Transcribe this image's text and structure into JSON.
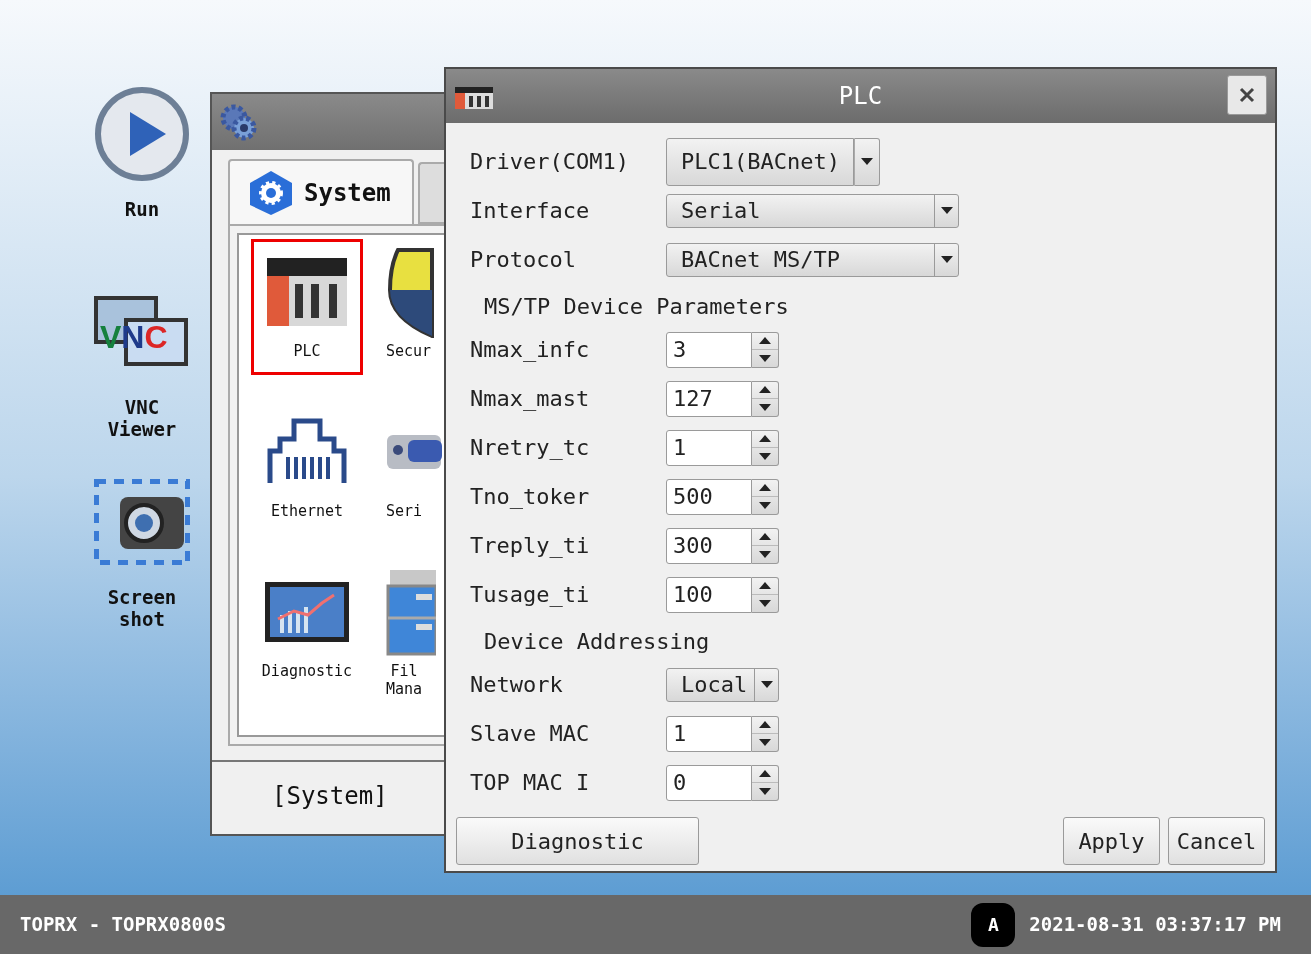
{
  "desktop_icons": [
    {
      "kind": "play",
      "label": "Run"
    },
    {
      "kind": "vnc",
      "label": "VNC\nViewer",
      "logo": [
        {
          "text": "V",
          "color": "#15803d"
        },
        {
          "text": "N",
          "color": "#1e3a8a"
        },
        {
          "text": "C",
          "color": "#dc2626"
        }
      ]
    },
    {
      "kind": "camera",
      "label": "Screen\nshot"
    }
  ],
  "system_window": {
    "tab": {
      "label": "System",
      "selected": true
    },
    "items": [
      {
        "kind": "plc",
        "label": "PLC",
        "selected": true
      },
      {
        "kind": "shield",
        "label": "Secur",
        "selected": false
      },
      {
        "kind": "ethernet",
        "label": "Ethernet",
        "selected": false
      },
      {
        "kind": "serial",
        "label": "Seri",
        "selected": false
      },
      {
        "kind": "chart",
        "label": "Diagnostic",
        "selected": false
      },
      {
        "kind": "file",
        "label": "Fil\nMana",
        "selected": false
      }
    ],
    "footer": "[System]"
  },
  "plc_dialog": {
    "title": "PLC",
    "rows": [
      {
        "kind": "split_dropdown",
        "label": "Driver(COM1)",
        "value": "PLC1(BACnet)"
      },
      {
        "kind": "dropdown",
        "label": "Interface",
        "value": "Serial"
      },
      {
        "kind": "dropdown",
        "label": "Protocol",
        "value": "BACnet MS/TP"
      },
      {
        "kind": "heading",
        "label": "MS/TP Device Parameters"
      },
      {
        "kind": "spinner",
        "label": "Nmax_infc",
        "value": "3"
      },
      {
        "kind": "spinner",
        "label": "Nmax_mast",
        "value": "127"
      },
      {
        "kind": "spinner",
        "label": "Nretry_tc",
        "value": "1"
      },
      {
        "kind": "spinner",
        "label": "Tno_toker",
        "value": "500"
      },
      {
        "kind": "spinner",
        "label": "Treply_ti",
        "value": "300"
      },
      {
        "kind": "spinner",
        "label": "Tusage_ti",
        "value": "100"
      },
      {
        "kind": "heading",
        "label": "Device Addressing"
      },
      {
        "kind": "compact_dropdown",
        "label": "Network",
        "value": "Local"
      },
      {
        "kind": "spinner",
        "label": "Slave MAC",
        "value": "1"
      },
      {
        "kind": "spinner",
        "label": "TOP MAC I",
        "value": "0"
      }
    ],
    "left_button": "Diagnostic",
    "right_buttons": [
      "Apply",
      "Cancel"
    ]
  },
  "taskbar": {
    "device": "TOPRX - TOPRX0800S",
    "badge": "A",
    "datetime": "2021-08-31 03:37:17 PM"
  }
}
